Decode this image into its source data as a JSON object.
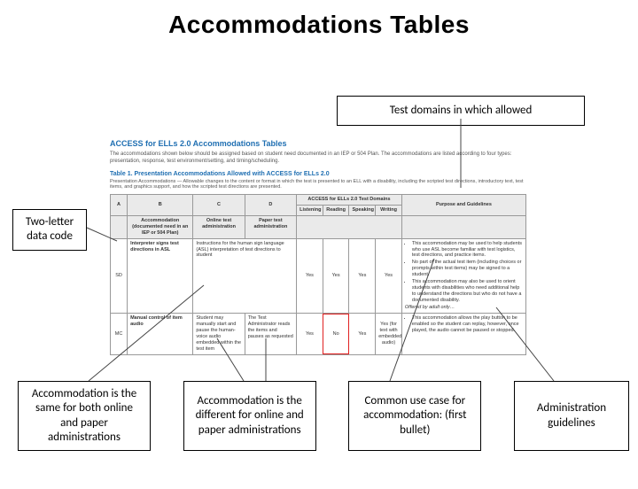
{
  "title": "Accommodations Tables",
  "callouts": {
    "top": "Test domains in which allowed",
    "left": "Two-letter data code",
    "bottom1": "Accommodation is the same for both online and paper administrations",
    "bottom2": "Accommodation is the different for online and paper administrations",
    "bottom3": "Common use case for accommodation: (first bullet)",
    "bottom4": "Administration guidelines"
  },
  "doc": {
    "heading": "ACCESS for ELLs 2.0 Accommodations Tables",
    "intro": "The accommodations shown below should be assigned based on student need documented in an IEP or 504 Plan. The accommodations are listed according to four types: presentation, response, test environment/setting, and timing/scheduling.",
    "tableTitle": "Table 1. Presentation Accommodations Allowed with ACCESS for ELLs 2.0",
    "tableDesc": "Presentation Accommodations — Allowable changes to the content or format in which the test is presented to an ELL with a disability, including the scripted test directions, introductory text, test items, and graphics support, and how the scripted test directions are presented.",
    "columns": {
      "A": "A",
      "B": "B",
      "C": "C",
      "D": "D",
      "domainsHead": "ACCESS for ELLs 2.0 Test Domains",
      "listening": "Listening",
      "reading": "Reading",
      "speaking": "Speaking",
      "writing": "Writing",
      "purpose": "Purpose and Guidelines",
      "accommodation": "Accommodation (documented need in an IEP or 504 Plan)",
      "online": "Online test administration",
      "paper": "Paper test administration"
    },
    "rows": [
      {
        "code": "SD",
        "acc": "Interpreter signs test directions in ASL",
        "online": "Instructions for the human sign language (ASL) interpretation of test directions to student",
        "paper": "",
        "listening": "Yes",
        "reading": "Yes",
        "speaking": "Yes",
        "writing": "Yes",
        "purpose": {
          "intro": "This accommodation may be used to help students who use ASL become familiar with test logistics, test directions, and practice items.",
          "bullets": [
            "No part of the actual test item (including choices or prompts within test items) may be signed to a student.",
            "This accommodation may also be used to orient students with disabilities who need additional help to understand the directions but who do not have a documented disability."
          ],
          "admin": "Offered by adult only…"
        }
      },
      {
        "code": "MC",
        "acc": "Manual control of item audio",
        "online": "Student may manually start and pause the human-voice audio embedded within the test item",
        "paper": "The Test Administrator reads the items and pauses as requested",
        "listening": "Yes",
        "reading": "No",
        "speaking": "Yes",
        "writing": "Yes (for text with embedded audio)",
        "purpose": {
          "intro": "This accommodation allows the play button to be enabled so the student can replay, however, once played, the audio cannot be paused or stopped.",
          "bullets": [],
          "admin": ""
        }
      }
    ]
  }
}
